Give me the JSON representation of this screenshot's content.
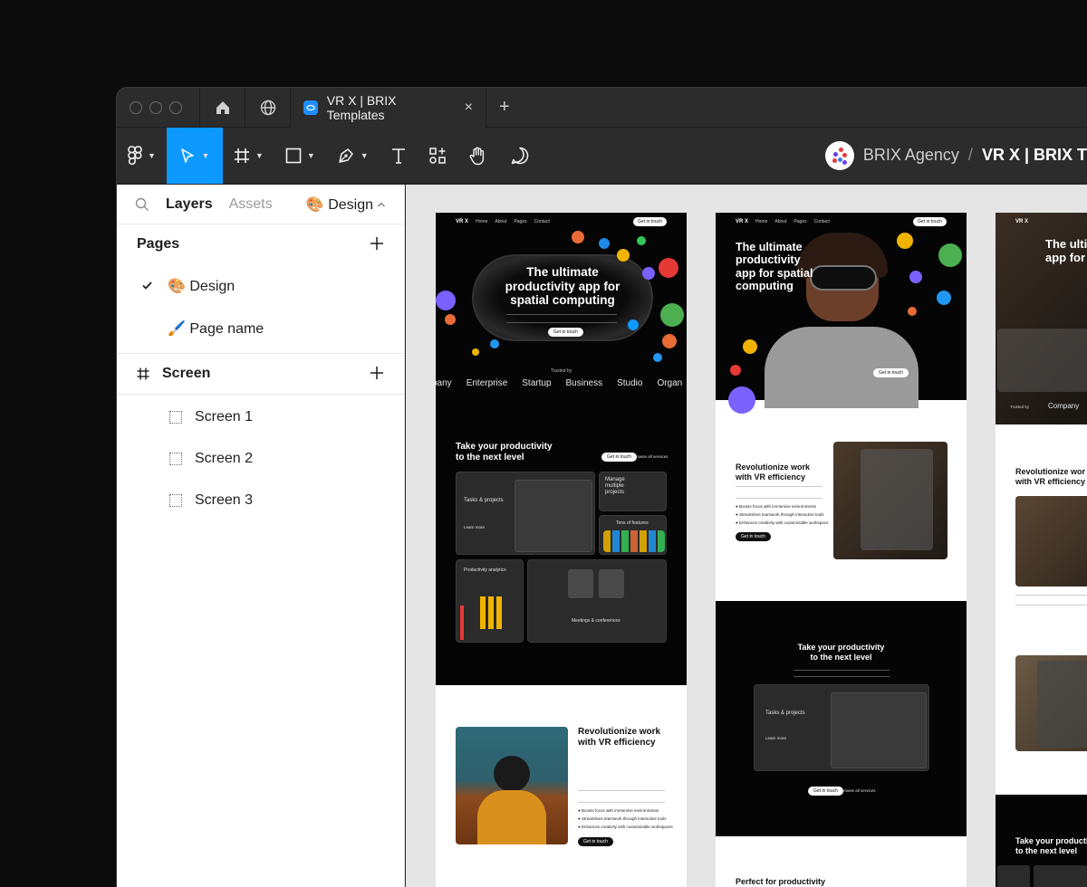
{
  "titlebar": {
    "tab_title": "VR X | BRIX Templates",
    "close_glyph": "×",
    "new_tab_glyph": "+"
  },
  "toolbar": {
    "tools": [
      "figma-menu",
      "move",
      "frame",
      "rectangle",
      "pen",
      "text",
      "resources",
      "hand",
      "comment"
    ],
    "active_tool": "move",
    "breadcrumb": {
      "team": "BRIX Agency",
      "separator": "/",
      "file": "VR X | BRIX T"
    }
  },
  "left_panel": {
    "tabs": {
      "layers": "Layers",
      "assets": "Assets"
    },
    "page_selector": "🎨 Design",
    "pages_title": "Pages",
    "pages": [
      {
        "label": "🎨 Design",
        "selected": true
      },
      {
        "label": "🖌️ Page name",
        "selected": false
      }
    ],
    "screen_title": "Screen",
    "screens": [
      "Screen 1",
      "Screen 2",
      "Screen 3"
    ]
  },
  "canvas": {
    "frame1": {
      "nav_logo": "VR X",
      "nav_links": [
        "Home",
        "About",
        "Pages",
        "Contact"
      ],
      "nav_cta": "Get in touch",
      "hero_line1": "The ultimate",
      "hero_line2": "productivity app for",
      "hero_line3": "spatial computing",
      "hero_cta": "Get in touch",
      "trusted": "Trusted by",
      "logos": [
        "pany",
        "Enterprise",
        "Startup",
        "Business",
        "Studio",
        "Organ"
      ],
      "section_title_1": "Take your productivity",
      "section_title_2": "to the next level",
      "btn_touch": "Get in touch",
      "btn_services": "Browse all services",
      "card_tasks": "Tasks & projects",
      "card_learn": "Learn more",
      "card_manage_1": "Manage",
      "card_manage_2": "multiple",
      "card_manage_3": "projects",
      "card_features": "Tens of features",
      "card_analytics": "Productivity analytics",
      "card_meetings": "Meetings & conferences",
      "rev_title_1": "Revolutionize work",
      "rev_title_2": "with VR efficiency",
      "bullets": [
        "Boosts focus with immersive environments",
        "Streamlines teamwork through interactive tools",
        "Enhances creativity with customizable workspaces"
      ],
      "rev_cta": "Get in touch"
    },
    "frame2": {
      "nav_logo": "VR X",
      "nav_links": [
        "Home",
        "About",
        "Pages",
        "Contact"
      ],
      "nav_cta": "Get in touch",
      "hero_line1": "The ultimate",
      "hero_line2": "productivity",
      "hero_line3": "app for spatial",
      "hero_line4": "computing",
      "hero_cta": "Get in touch",
      "rev_title_1": "Revolutionize work",
      "rev_title_2": "with VR efficiency",
      "bullets": [
        "Boosts focus with immersive environments",
        "Streamlines teamwork through interactive tools",
        "Enhances creativity with customizable workspace"
      ],
      "rev_cta": "Get in touch",
      "section_title_1": "Take your productivity",
      "section_title_2": "to the next level",
      "card_tasks": "Tasks & projects",
      "card_learn": "Learn more",
      "btn_touch": "Get in touch",
      "btn_services": "Browse all services",
      "perfect": "Perfect for productivity"
    },
    "frame3": {
      "nav_logo": "VR X",
      "hero_line1": "The ulti",
      "hero_line2": "app for",
      "trusted": "Trusted by",
      "logos": [
        "Company",
        "En"
      ],
      "rev_title_1": "Revolutionize wor",
      "rev_title_2": "with VR efficiency",
      "section_title_1": "Take your productive",
      "section_title_2": "to the next level"
    }
  },
  "colors": {
    "accent": "#0d99ff",
    "chrome": "#2c2c2c",
    "canvas": "#e5e5e5"
  }
}
